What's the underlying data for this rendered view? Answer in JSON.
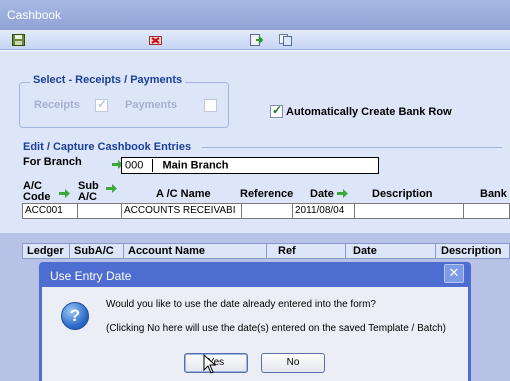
{
  "window": {
    "title": "Cashbook"
  },
  "toolbar": {
    "icons": [
      "save-icon",
      "delete-icon",
      "export-icon",
      "copy-icon"
    ]
  },
  "select_group": {
    "title": "Select - Receipts / Payments",
    "receipts_label": "Receipts",
    "payments_label": "Payments",
    "auto_bank_label": "Automatically Create Bank Row"
  },
  "edit_section": {
    "title": "Edit / Capture Cashbook Entries",
    "branch_label": "For Branch",
    "branch_code": "000",
    "branch_name": "Main Branch"
  },
  "entry_headers": {
    "ac_code_1": "A/C",
    "ac_code_2": "Code",
    "sub_ac_1": "Sub",
    "sub_ac_2": "A/C",
    "ac_name": "A /C Name",
    "reference": "Reference",
    "date": "Date",
    "description": "Description",
    "bank": "Bank"
  },
  "entry_row": {
    "ac_code": "ACC001",
    "sub_ac": "",
    "ac_name": "ACCOUNTS RECEIVABI",
    "reference": "",
    "date": "2011/08/04",
    "description": "",
    "bank": ""
  },
  "grid": {
    "columns": [
      "Ledger",
      "SubA/C",
      "Account Name",
      "Ref",
      "Date",
      "Description"
    ]
  },
  "dialog": {
    "title": "Use Entry Date",
    "close_glyph": "✕",
    "icon_glyph": "?",
    "message_line1": "Would you like to use the date already entered into the form?",
    "message_line2": "(Clicking No here will use the date(s) entered on the saved Template / Batch)",
    "yes_label": "Yes",
    "no_label": "No"
  },
  "colors": {
    "title_bar": "#8fa3d7",
    "panel": "#dde6f8",
    "dialog_frame": "#4d6dd0",
    "label_blue": "#1d3f9a",
    "arrow_green": "#3aa83a"
  }
}
